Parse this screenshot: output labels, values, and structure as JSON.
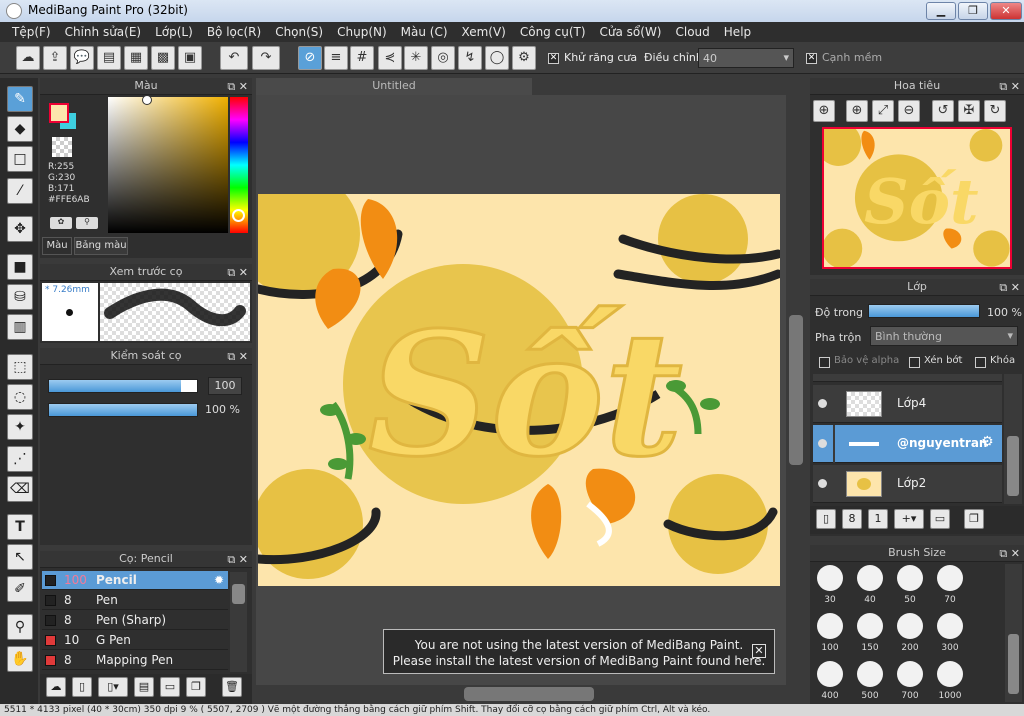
{
  "window": {
    "title": "MediBang Paint Pro (32bit)"
  },
  "menu": [
    "Tệp(F)",
    "Chỉnh sửa(E)",
    "Lớp(L)",
    "Bộ lọc(R)",
    "Chọn(S)",
    "Chụp(N)",
    "Màu (C)",
    "Xem(V)",
    "Công cụ(T)",
    "Cửa sổ(W)",
    "Cloud",
    "Help"
  ],
  "toolbar": {
    "antialias_label": "Khử răng cưa",
    "adjust_label": "Điều chỉnh",
    "adjust_value": "40",
    "soft_edge_label": "Cạnh mềm"
  },
  "color_panel": {
    "title": "Màu",
    "r": "R:255",
    "g": "G:230",
    "b": "B:171",
    "hex": "#FFE6AB",
    "tab_color": "Màu",
    "tab_palette": "Bảng màu",
    "primary": "#fde5ac",
    "secondary": "#3ecfe0"
  },
  "brush_preview": {
    "title": "Xem trước cọ",
    "size": "* 7.26mm"
  },
  "brush_control": {
    "title": "Kiểm soát cọ",
    "size_value": "100",
    "opacity_value": "100 %",
    "size_fraction": 0.89,
    "opacity_fraction": 1.0
  },
  "canvas": {
    "tab": "Untitled"
  },
  "brush_panel": {
    "title": "Cọ: Pencil",
    "items": [
      {
        "size": "100",
        "name": "Pencil",
        "color": "#222222",
        "selected": true
      },
      {
        "size": "8",
        "name": "Pen",
        "color": "#222222"
      },
      {
        "size": "8",
        "name": "Pen (Sharp)",
        "color": "#222222"
      },
      {
        "size": "10",
        "name": "G Pen",
        "color": "#e03a3a"
      },
      {
        "size": "8",
        "name": "Mapping Pen",
        "color": "#e03a3a"
      }
    ]
  },
  "navigator": {
    "title": "Hoa tiêu"
  },
  "layer_panel": {
    "title": "Lớp",
    "opacity_label": "Độ trong",
    "opacity_value": "100 %",
    "opacity_fraction": 1.0,
    "blend_label": "Pha trộn",
    "blend_value": "Bình thường",
    "protect_alpha": "Bảo vệ alpha",
    "clipping": "Xén bớt",
    "lock": "Khóa",
    "layers": [
      {
        "name": "Lớp4"
      },
      {
        "name": "@nguyentran"
      },
      {
        "name": "Lớp2"
      }
    ]
  },
  "brush_size_panel": {
    "title": "Brush Size",
    "sizes": [
      "30",
      "40",
      "50",
      "70",
      "100",
      "150",
      "200",
      "300",
      "400",
      "500",
      "700",
      "1000"
    ]
  },
  "notice": {
    "line1": "You are not using the latest version of MediBang Paint.",
    "line2": "Please install the latest version of MediBang Paint found here."
  },
  "status": "5511 * 4133 pixel  (40 * 30cm)  350 dpi  9 %  ( 5507, 2709 )  Vẽ một đường thẳng bằng cách giữ phím Shift. Thay đổi cỡ cọ bằng cách giữ phím Ctrl, Alt và kéo."
}
